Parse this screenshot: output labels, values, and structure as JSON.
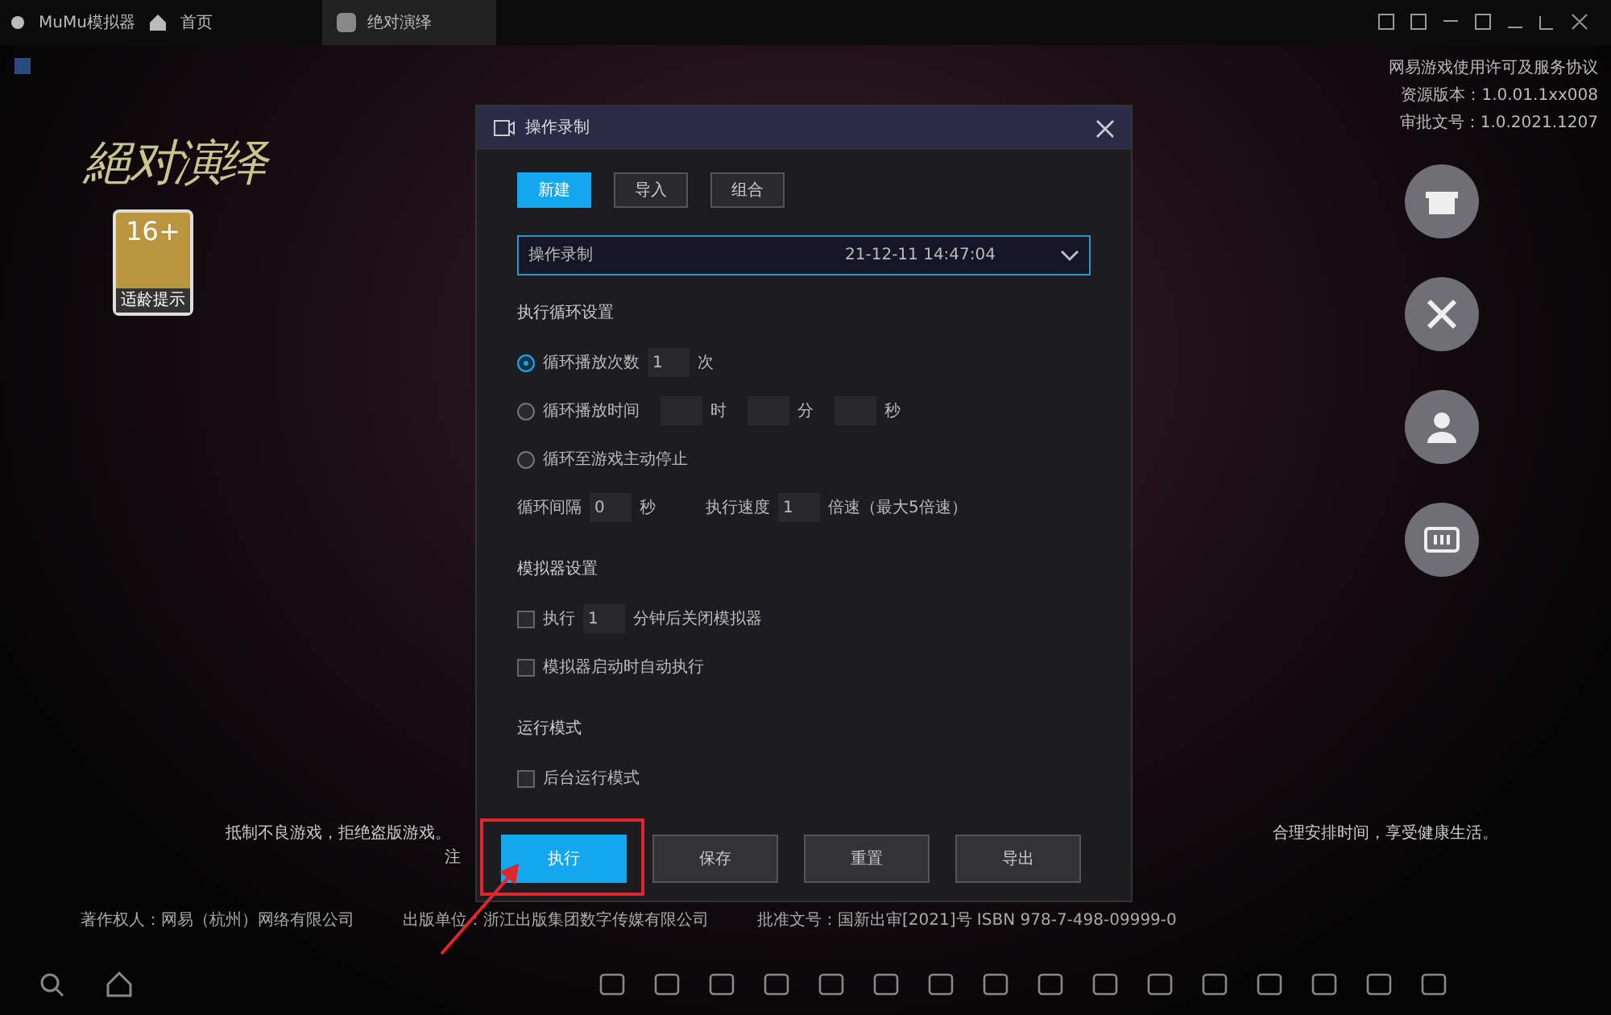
{
  "app": {
    "title": "MuMu模拟器",
    "home_label": "首页",
    "tab_label": "绝对演绎"
  },
  "game": {
    "logo_text": "絕对演绎",
    "age_rating": "16+",
    "age_label": "适龄提示"
  },
  "info_lines": [
    "网易游戏使用许可及服务协议",
    "资源版本：1.0.01.1xx008",
    "审批文号：1.0.2021.1207"
  ],
  "notice": {
    "left": "抵制不良游戏，拒绝盗版游戏。",
    "right": "合理安排时间，享受健康生活。",
    "note": "注",
    "credits": [
      "著作权人：网易（杭州）网络有限公司",
      "出版单位：浙江出版集团数字传媒有限公司",
      "批准文号：国新出审[2021]号 ISBN 978-7-498-09999-0"
    ]
  },
  "dialog": {
    "title": "操作录制",
    "tabs": [
      {
        "label": "新建",
        "selected": true
      },
      {
        "label": "导入",
        "selected": false
      },
      {
        "label": "组合",
        "selected": false
      }
    ],
    "recording": {
      "name": "操作录制",
      "time": "21-12-11 14:47:04"
    },
    "loop_section": "执行循环设置",
    "loop_options": [
      {
        "kind": "count",
        "label": "循环播放次数",
        "selected": true,
        "value": "1",
        "unit": "次"
      },
      {
        "kind": "time",
        "label": "循环播放时间",
        "selected": false,
        "units": [
          "时",
          "分",
          "秒"
        ]
      },
      {
        "kind": "plain",
        "label": "循环至游戏主动停止",
        "selected": false
      }
    ],
    "interval": {
      "label": "循环间隔",
      "value": "0",
      "unit": "秒"
    },
    "speed": {
      "label": "执行速度",
      "value": "1",
      "unit": "倍速（最大5倍速）"
    },
    "emulator_section": "模拟器设置",
    "emulator_options": [
      {
        "kind": "close",
        "checked": false,
        "prefix": "执行",
        "value": "1",
        "suffix": "分钟后关闭模拟器"
      },
      {
        "kind": "plain",
        "checked": false,
        "label": "模拟器启动时自动执行"
      }
    ],
    "mode_section": "运行模式",
    "mode_options": [
      {
        "label": "后台运行模式",
        "checked": false
      }
    ],
    "buttons": [
      {
        "label": "执行",
        "primary": true,
        "highlighted": true
      },
      {
        "label": "保存",
        "primary": false,
        "highlighted": false
      },
      {
        "label": "重置",
        "primary": false,
        "highlighted": false
      },
      {
        "label": "导出",
        "primary": false,
        "highlighted": false
      }
    ]
  }
}
